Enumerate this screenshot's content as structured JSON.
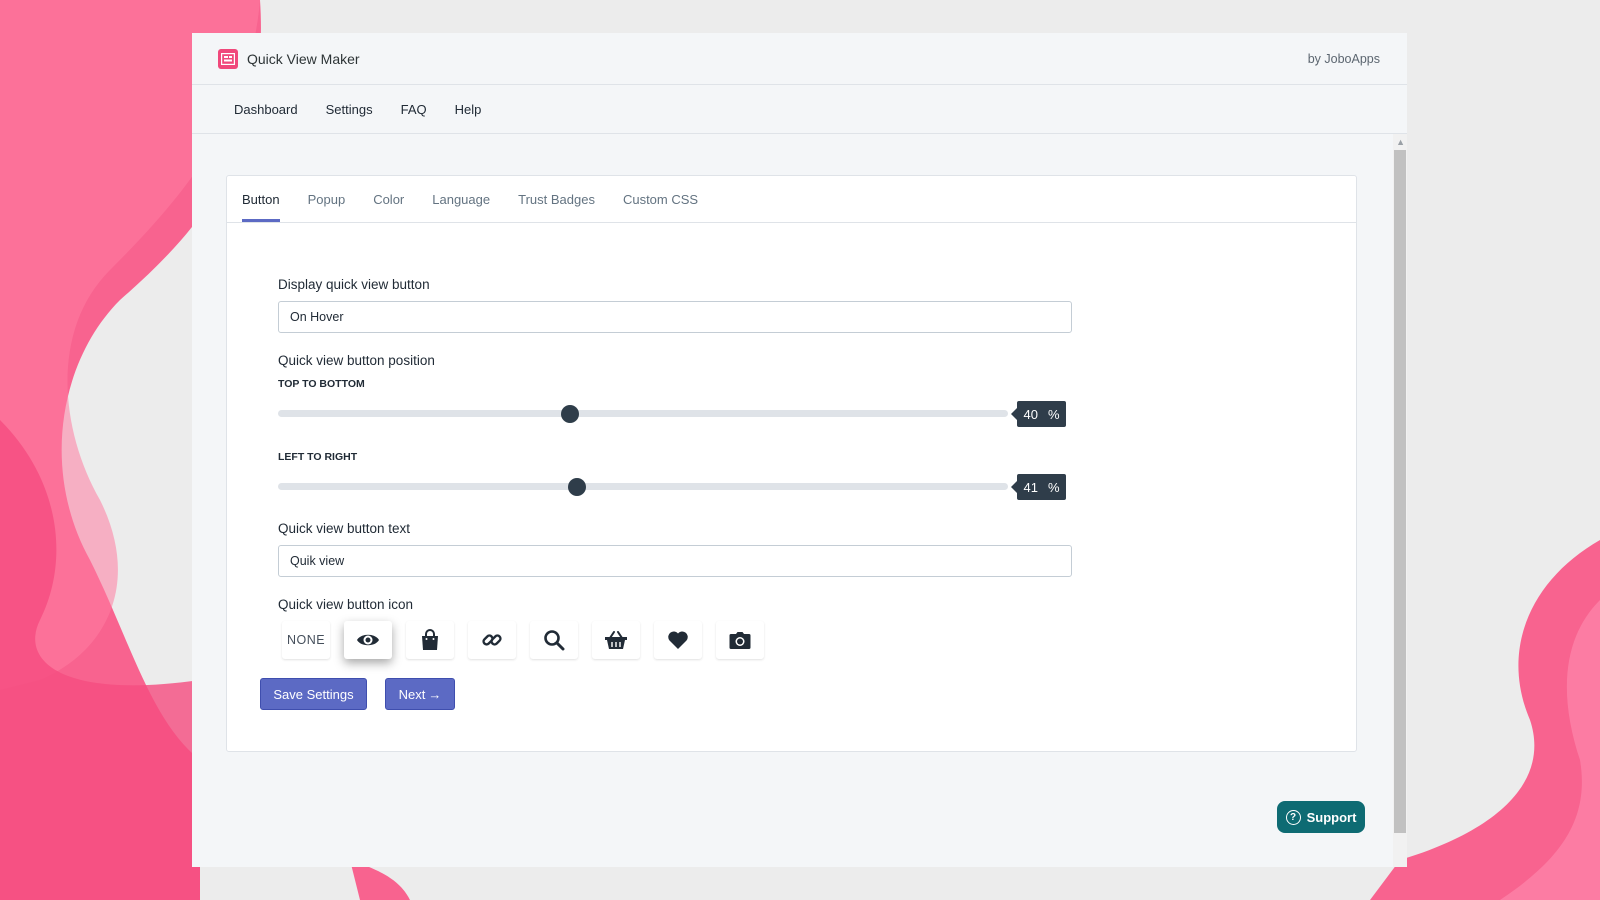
{
  "app": {
    "title": "Quick View Maker",
    "byline": "by JoboApps"
  },
  "menu": [
    "Dashboard",
    "Settings",
    "FAQ",
    "Help"
  ],
  "tabs": [
    "Button",
    "Popup",
    "Color",
    "Language",
    "Trust Badges",
    "Custom CSS"
  ],
  "active_tab": "Button",
  "form": {
    "display_label": "Display quick view button",
    "display_value": "On Hover",
    "position_label": "Quick view button position",
    "top_to_bottom": {
      "label": "TOP TO BOTTOM",
      "value": 40,
      "value_text": "40",
      "unit": "%"
    },
    "left_to_right": {
      "label": "LEFT TO RIGHT",
      "value": 41,
      "value_text": "41",
      "unit": "%"
    },
    "text_label": "Quick view button text",
    "text_value": "Quik view",
    "icon_label": "Quick view button icon",
    "icon_none": "NONE",
    "icons": [
      "eye-icon",
      "shopping-bag-icon",
      "link-icon",
      "search-icon",
      "basket-icon",
      "heart-icon",
      "camera-icon"
    ],
    "selected_icon": "eye-icon"
  },
  "buttons": {
    "save": "Save Settings",
    "next": "Next"
  },
  "support": "Support",
  "colors": {
    "accent": "#5c6ac4",
    "slider": "#2f3d4a",
    "support": "#0e6b73",
    "logo": "#f0487b",
    "background": "#f8638f"
  }
}
